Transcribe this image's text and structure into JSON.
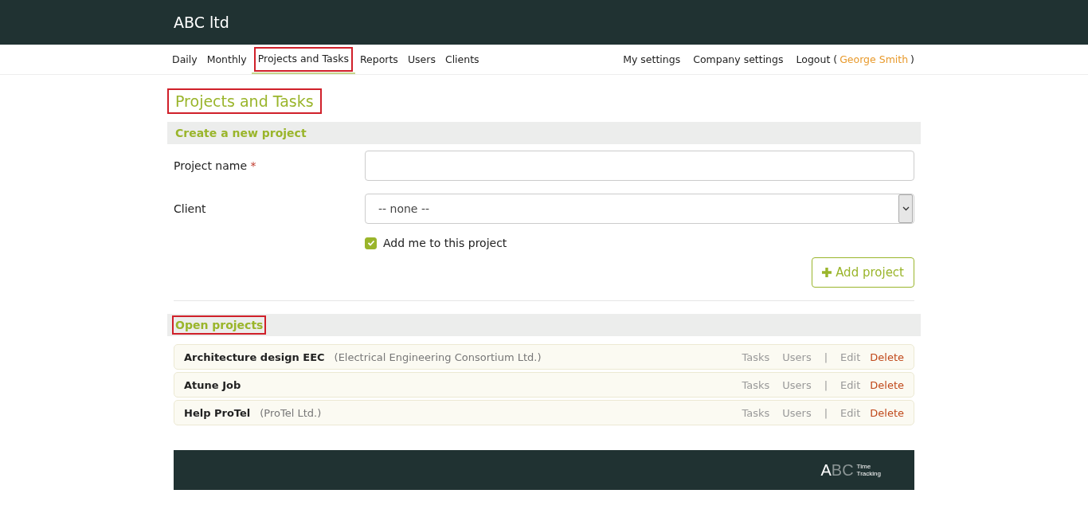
{
  "header": {
    "title": "ABC ltd"
  },
  "nav": {
    "left": [
      {
        "label": "Daily",
        "selected": false,
        "highlighted": false
      },
      {
        "label": "Monthly",
        "selected": false,
        "highlighted": false
      },
      {
        "label": "Projects and Tasks",
        "selected": true,
        "highlighted": true
      },
      {
        "label": "Reports",
        "selected": false,
        "highlighted": false
      },
      {
        "label": "Users",
        "selected": false,
        "highlighted": false
      },
      {
        "label": "Clients",
        "selected": false,
        "highlighted": false
      }
    ],
    "right": [
      "My settings",
      "Company settings"
    ],
    "logout": {
      "label": "Logout (",
      "user": "George Smith",
      "close": ")"
    }
  },
  "page_title": {
    "text": "Projects and Tasks",
    "highlighted": true
  },
  "create_section": {
    "heading": "Create a new project",
    "highlighted": false,
    "project_name": {
      "label": "Project name",
      "required_mark": "*"
    },
    "client": {
      "label": "Client",
      "value": "-- none --"
    },
    "add_me": {
      "label": "Add me to this project",
      "checked": true
    },
    "submit": "Add project"
  },
  "open_section": {
    "heading": "Open projects",
    "highlighted": true,
    "projects": [
      {
        "name": "Architecture design EEC",
        "client": "(Electrical Engineering Consortium Ltd.)",
        "actions": {
          "tasks": "Tasks",
          "users": "Users",
          "separator": "|",
          "edit": "Edit",
          "delete": "Delete"
        }
      },
      {
        "name": "Atune Job",
        "actions": {
          "tasks": "Tasks",
          "users": "Users",
          "separator": "|",
          "edit": "Edit",
          "delete": "Delete"
        }
      },
      {
        "name": "Help ProTel",
        "client": "(ProTel Ltd.)",
        "actions": {
          "tasks": "Tasks",
          "users": "Users",
          "separator": "|",
          "edit": "Edit",
          "delete": "Delete"
        }
      }
    ]
  },
  "footer": {
    "logo_a": "A",
    "logo_bc": "BC",
    "logo_line1": "Time",
    "logo_line2": "Tracking"
  }
}
